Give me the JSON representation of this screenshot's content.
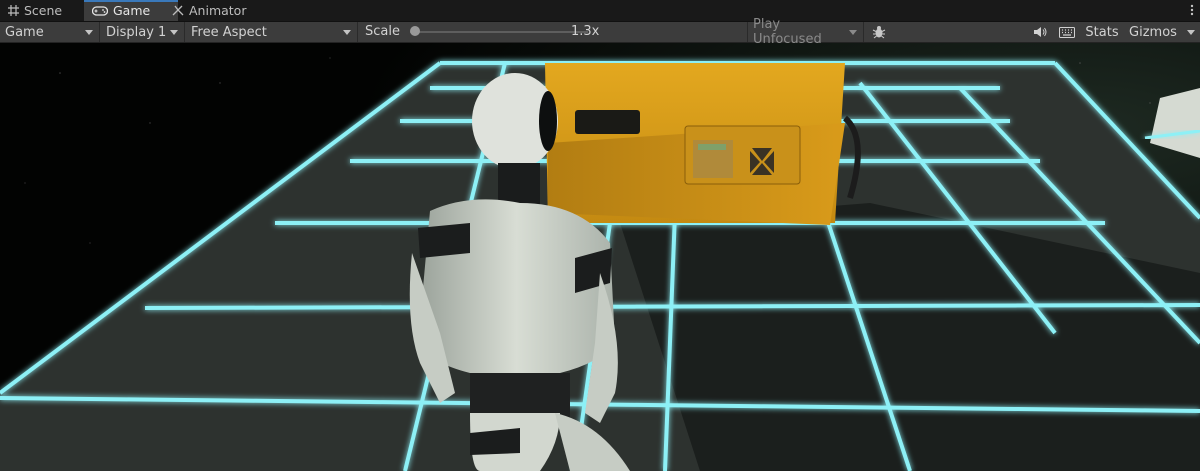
{
  "tabs": [
    {
      "label": "Scene",
      "icon": "grid-icon"
    },
    {
      "label": "Game",
      "icon": "gamepad-icon"
    },
    {
      "label": "Animator",
      "icon": "animator-icon"
    }
  ],
  "toolbar": {
    "view_dropdown": "Game",
    "display_dropdown": "Display 1",
    "aspect_dropdown": "Free Aspect",
    "scale_label": "Scale",
    "scale_value": "1.3x",
    "scale_level": 0.03,
    "play_mode_dropdown": "Play Unfocused",
    "stats_label": "Stats",
    "gizmos_label": "Gizmos"
  },
  "icons": {
    "bug": "bug-icon",
    "mute": "speaker-icon",
    "shortcuts": "keyboard-icon",
    "more": "vertical-dots-icon"
  },
  "colors": {
    "grid_glow": "#6ee4f0",
    "crate": "#e7a21b",
    "active_tab_accent": "#3a79bb"
  }
}
